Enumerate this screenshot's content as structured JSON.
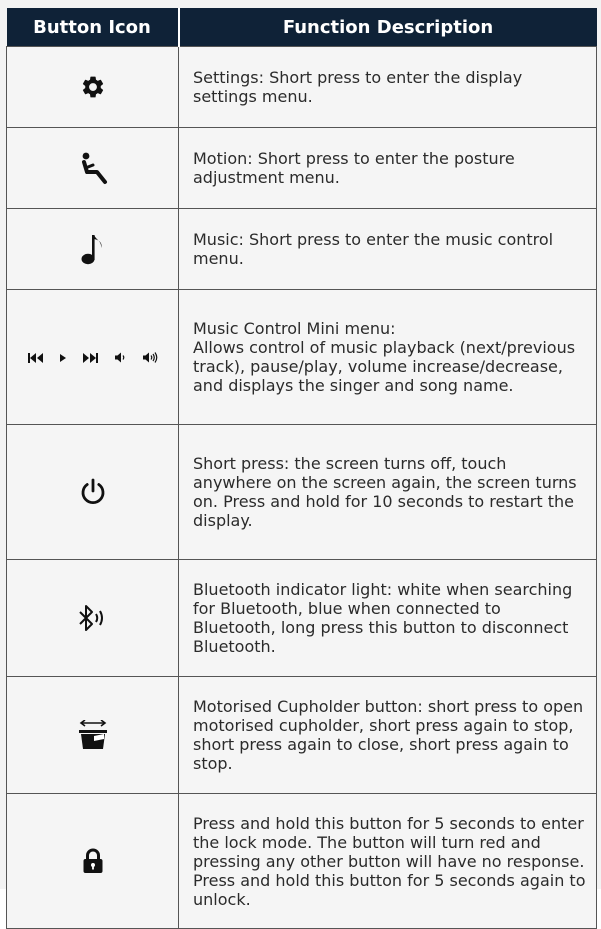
{
  "table": {
    "headers": [
      "Button Icon",
      "Function Description"
    ],
    "rows": [
      {
        "icon": "gear-icon",
        "description": [
          "Settings: Short press to enter the display settings menu."
        ]
      },
      {
        "icon": "reclining-person-icon",
        "description": [
          "Motion: Short press to enter the posture adjustment menu."
        ]
      },
      {
        "icon": "music-note-icon",
        "description": [
          "Music: Short press to enter the music control menu."
        ]
      },
      {
        "icon": "media-controls-icons",
        "description": [
          "Music Control Mini menu:",
          "Allows control of music playback (next/previous track), pause/play, volume increase/decrease, and displays the singer and song name."
        ]
      },
      {
        "icon": "power-icon",
        "description": [
          "Short press: the screen turns off, touch anywhere on the screen again, the screen turns on.  Press and hold for 10 seconds to restart the display."
        ]
      },
      {
        "icon": "bluetooth-icon",
        "description": [
          "Bluetooth indicator light: white when searching for Bluetooth, blue when connected to Bluetooth, long press this button to disconnect Bluetooth."
        ]
      },
      {
        "icon": "cupholder-icon",
        "description": [
          "Motorised Cupholder button: short press to open motorised cupholder, short press again to stop, short press again to close, short press again to stop."
        ]
      },
      {
        "icon": "lock-icon",
        "description": [
          "Press and hold this button for 5 seconds to enter the lock mode. The button will turn red and pressing any other button will have no response. Press and hold this button for 5 seconds again to unlock."
        ]
      }
    ]
  },
  "colors": {
    "header_bg": "#0f2237",
    "header_text": "#ffffff",
    "border": "#555555",
    "icon": "#111111"
  }
}
